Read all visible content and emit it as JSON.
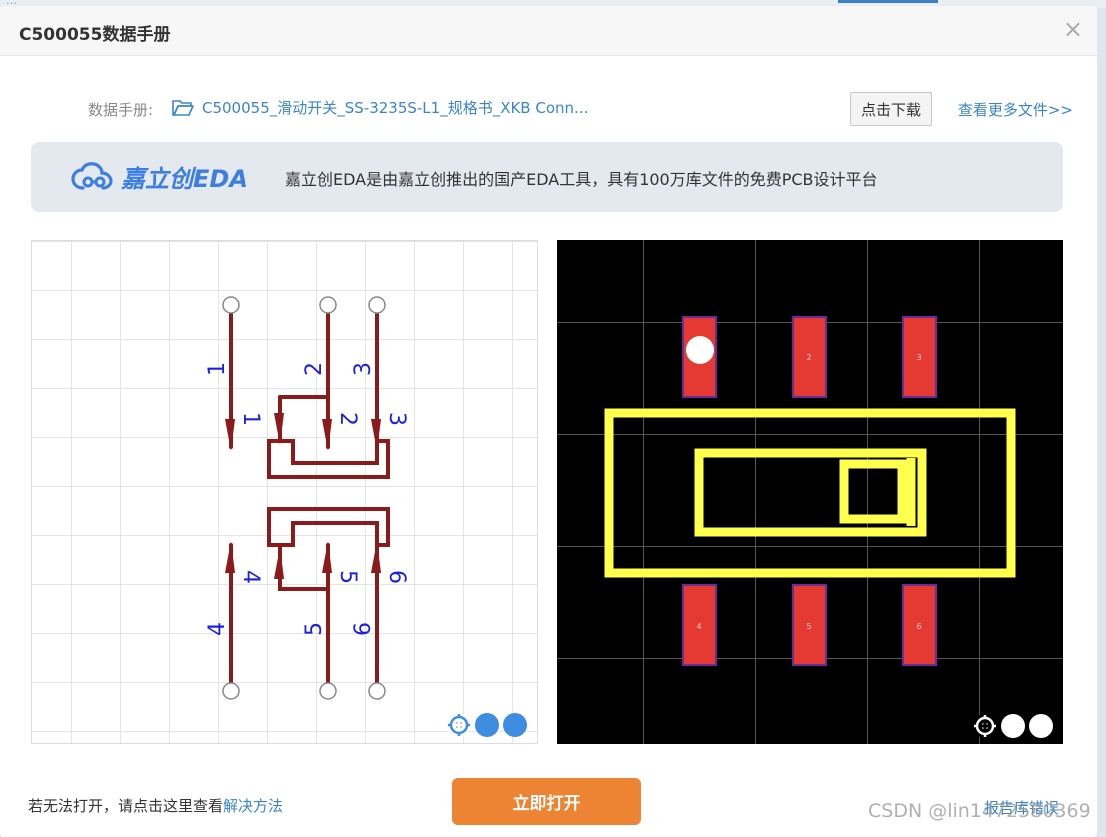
{
  "background": {
    "text": "…"
  },
  "modal": {
    "title": "C500055数据手册",
    "close_glyph": "×"
  },
  "datasheet": {
    "label": "数据手册:",
    "file_icon": "folder-open-icon",
    "file_name": "C500055_滑动开关_SS-3235S-L1_规格书_XKB Conn...",
    "download_label": "点击下载",
    "more_label": "查看更多文件>>"
  },
  "banner": {
    "logo_text": "嘉立创EDA",
    "logo_icon": "cloud-link-icon",
    "description": "嘉立创EDA是由嘉立创推出的国产EDA工具，具有100万库文件的免费PCB设计平台"
  },
  "schematic": {
    "pins": [
      {
        "num": "1",
        "name": "1"
      },
      {
        "num": "2",
        "name": "2"
      },
      {
        "num": "3",
        "name": "3"
      },
      {
        "num": "4",
        "name": "4"
      },
      {
        "num": "5",
        "name": "5"
      },
      {
        "num": "6",
        "name": "6"
      }
    ],
    "colors": {
      "wire": "#8b1a1a",
      "pin_text": "#1f1fe0"
    },
    "controls": [
      "locate-icon",
      "zoom-out-icon",
      "zoom-in-icon"
    ]
  },
  "pcb": {
    "pads": [
      "1",
      "2",
      "3",
      "4",
      "5",
      "6"
    ],
    "colors": {
      "pad": "#e53a32",
      "silkscreen": "#ffff4d"
    },
    "controls": [
      "locate-icon",
      "zoom-out-icon",
      "zoom-in-icon"
    ]
  },
  "footer": {
    "help_text": "若无法打开，请点击这里查看",
    "help_link": "解决方法",
    "open_label": "立即打开",
    "report_label": "报告库错误"
  },
  "watermark": "CSDN @lin1472580369"
}
